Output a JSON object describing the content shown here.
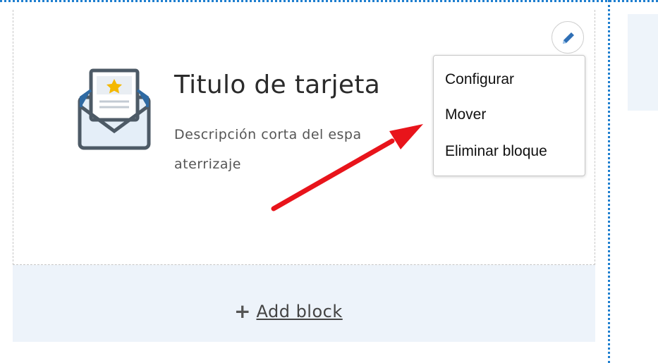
{
  "card": {
    "title": "Titulo de tarjeta",
    "description_line1": "Descripción corta del espa",
    "description_line2": "aterrizaje",
    "icon": "envelope-star-icon"
  },
  "edit_button": {
    "icon": "pencil-icon"
  },
  "context_menu": {
    "items": [
      {
        "label": "Configurar"
      },
      {
        "label": "Mover"
      },
      {
        "label": "Eliminar bloque"
      }
    ]
  },
  "add_block": {
    "icon": "plus-icon",
    "label": "Add block"
  },
  "colors": {
    "accent": "#1f7fcf",
    "pencil": "#2f6fb5",
    "annotation_arrow": "#e8141b",
    "add_area_bg": "#edf3fa"
  }
}
